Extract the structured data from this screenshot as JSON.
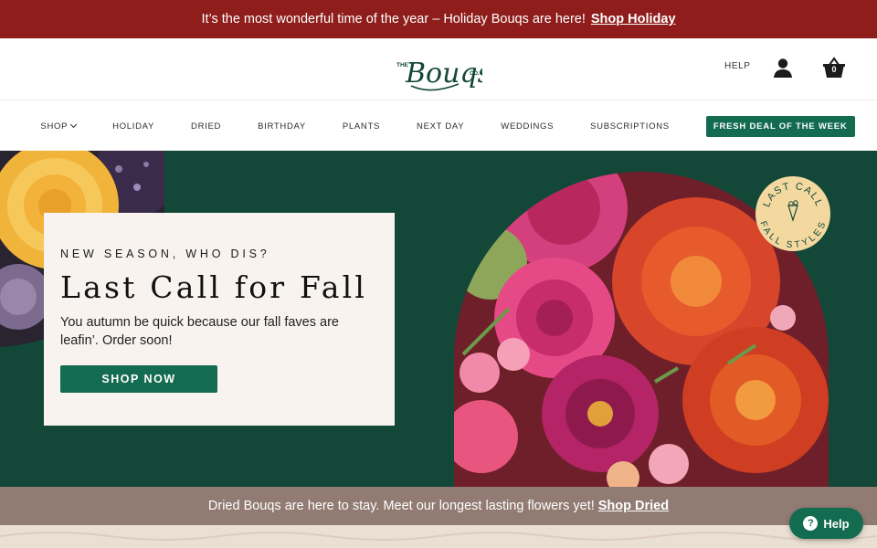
{
  "promo": {
    "text": "It’s the most wonderful time of the year – Holiday Bouqs are here!",
    "link": "Shop Holiday"
  },
  "header": {
    "logo_small_top": "THE",
    "logo_main": "Bouqs",
    "logo_small_bottom": "CO.",
    "help": "HELP",
    "cart_count": "0"
  },
  "nav": {
    "items": [
      "SHOP",
      "HOLIDAY",
      "DRIED",
      "BIRTHDAY",
      "PLANTS",
      "NEXT DAY",
      "WEDDINGS",
      "SUBSCRIPTIONS"
    ],
    "deal": "FRESH DEAL OF THE WEEK"
  },
  "hero": {
    "eyebrow": "NEW SEASON, WHO DIS?",
    "title": "Last Call for Fall",
    "subtitle": "You autumn be quick because our fall faves are leafin’. Order soon!",
    "button": "SHOP NOW",
    "badge_line1": "LAST CALL",
    "badge_line2": "FALL STYLES"
  },
  "sub_promo": {
    "text": "Dried Bouqs are here to stay. Meet our longest lasting flowers yet!",
    "link": "Shop Dried"
  },
  "help_widget": {
    "label": "Help",
    "icon": "question-icon"
  },
  "colors": {
    "promo": "#8e1d1b",
    "hero_bg": "#134838",
    "brand_green": "#136b50",
    "sub_promo": "#917b72",
    "badge": "#f3d9a0"
  }
}
